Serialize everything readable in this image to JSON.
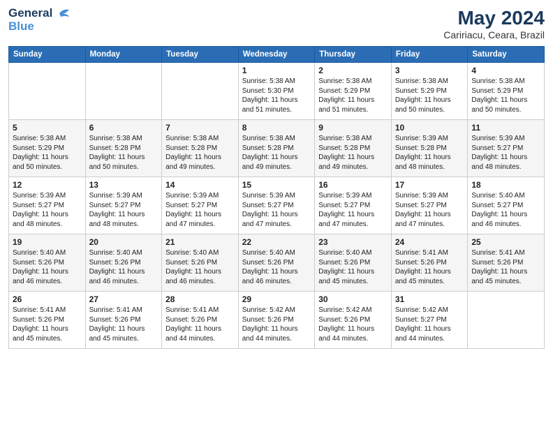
{
  "logo": {
    "line1": "General",
    "line2": "Blue"
  },
  "header": {
    "month_year": "May 2024",
    "location": "Caririacu, Ceara, Brazil"
  },
  "days_of_week": [
    "Sunday",
    "Monday",
    "Tuesday",
    "Wednesday",
    "Thursday",
    "Friday",
    "Saturday"
  ],
  "weeks": [
    [
      {
        "day": "",
        "sunrise": "",
        "sunset": "",
        "daylight": ""
      },
      {
        "day": "",
        "sunrise": "",
        "sunset": "",
        "daylight": ""
      },
      {
        "day": "",
        "sunrise": "",
        "sunset": "",
        "daylight": ""
      },
      {
        "day": "1",
        "sunrise": "Sunrise: 5:38 AM",
        "sunset": "Sunset: 5:30 PM",
        "daylight": "Daylight: 11 hours and 51 minutes."
      },
      {
        "day": "2",
        "sunrise": "Sunrise: 5:38 AM",
        "sunset": "Sunset: 5:29 PM",
        "daylight": "Daylight: 11 hours and 51 minutes."
      },
      {
        "day": "3",
        "sunrise": "Sunrise: 5:38 AM",
        "sunset": "Sunset: 5:29 PM",
        "daylight": "Daylight: 11 hours and 50 minutes."
      },
      {
        "day": "4",
        "sunrise": "Sunrise: 5:38 AM",
        "sunset": "Sunset: 5:29 PM",
        "daylight": "Daylight: 11 hours and 50 minutes."
      }
    ],
    [
      {
        "day": "5",
        "sunrise": "Sunrise: 5:38 AM",
        "sunset": "Sunset: 5:29 PM",
        "daylight": "Daylight: 11 hours and 50 minutes."
      },
      {
        "day": "6",
        "sunrise": "Sunrise: 5:38 AM",
        "sunset": "Sunset: 5:28 PM",
        "daylight": "Daylight: 11 hours and 50 minutes."
      },
      {
        "day": "7",
        "sunrise": "Sunrise: 5:38 AM",
        "sunset": "Sunset: 5:28 PM",
        "daylight": "Daylight: 11 hours and 49 minutes."
      },
      {
        "day": "8",
        "sunrise": "Sunrise: 5:38 AM",
        "sunset": "Sunset: 5:28 PM",
        "daylight": "Daylight: 11 hours and 49 minutes."
      },
      {
        "day": "9",
        "sunrise": "Sunrise: 5:38 AM",
        "sunset": "Sunset: 5:28 PM",
        "daylight": "Daylight: 11 hours and 49 minutes."
      },
      {
        "day": "10",
        "sunrise": "Sunrise: 5:39 AM",
        "sunset": "Sunset: 5:28 PM",
        "daylight": "Daylight: 11 hours and 48 minutes."
      },
      {
        "day": "11",
        "sunrise": "Sunrise: 5:39 AM",
        "sunset": "Sunset: 5:27 PM",
        "daylight": "Daylight: 11 hours and 48 minutes."
      }
    ],
    [
      {
        "day": "12",
        "sunrise": "Sunrise: 5:39 AM",
        "sunset": "Sunset: 5:27 PM",
        "daylight": "Daylight: 11 hours and 48 minutes."
      },
      {
        "day": "13",
        "sunrise": "Sunrise: 5:39 AM",
        "sunset": "Sunset: 5:27 PM",
        "daylight": "Daylight: 11 hours and 48 minutes."
      },
      {
        "day": "14",
        "sunrise": "Sunrise: 5:39 AM",
        "sunset": "Sunset: 5:27 PM",
        "daylight": "Daylight: 11 hours and 47 minutes."
      },
      {
        "day": "15",
        "sunrise": "Sunrise: 5:39 AM",
        "sunset": "Sunset: 5:27 PM",
        "daylight": "Daylight: 11 hours and 47 minutes."
      },
      {
        "day": "16",
        "sunrise": "Sunrise: 5:39 AM",
        "sunset": "Sunset: 5:27 PM",
        "daylight": "Daylight: 11 hours and 47 minutes."
      },
      {
        "day": "17",
        "sunrise": "Sunrise: 5:39 AM",
        "sunset": "Sunset: 5:27 PM",
        "daylight": "Daylight: 11 hours and 47 minutes."
      },
      {
        "day": "18",
        "sunrise": "Sunrise: 5:40 AM",
        "sunset": "Sunset: 5:27 PM",
        "daylight": "Daylight: 11 hours and 46 minutes."
      }
    ],
    [
      {
        "day": "19",
        "sunrise": "Sunrise: 5:40 AM",
        "sunset": "Sunset: 5:26 PM",
        "daylight": "Daylight: 11 hours and 46 minutes."
      },
      {
        "day": "20",
        "sunrise": "Sunrise: 5:40 AM",
        "sunset": "Sunset: 5:26 PM",
        "daylight": "Daylight: 11 hours and 46 minutes."
      },
      {
        "day": "21",
        "sunrise": "Sunrise: 5:40 AM",
        "sunset": "Sunset: 5:26 PM",
        "daylight": "Daylight: 11 hours and 46 minutes."
      },
      {
        "day": "22",
        "sunrise": "Sunrise: 5:40 AM",
        "sunset": "Sunset: 5:26 PM",
        "daylight": "Daylight: 11 hours and 46 minutes."
      },
      {
        "day": "23",
        "sunrise": "Sunrise: 5:40 AM",
        "sunset": "Sunset: 5:26 PM",
        "daylight": "Daylight: 11 hours and 45 minutes."
      },
      {
        "day": "24",
        "sunrise": "Sunrise: 5:41 AM",
        "sunset": "Sunset: 5:26 PM",
        "daylight": "Daylight: 11 hours and 45 minutes."
      },
      {
        "day": "25",
        "sunrise": "Sunrise: 5:41 AM",
        "sunset": "Sunset: 5:26 PM",
        "daylight": "Daylight: 11 hours and 45 minutes."
      }
    ],
    [
      {
        "day": "26",
        "sunrise": "Sunrise: 5:41 AM",
        "sunset": "Sunset: 5:26 PM",
        "daylight": "Daylight: 11 hours and 45 minutes."
      },
      {
        "day": "27",
        "sunrise": "Sunrise: 5:41 AM",
        "sunset": "Sunset: 5:26 PM",
        "daylight": "Daylight: 11 hours and 45 minutes."
      },
      {
        "day": "28",
        "sunrise": "Sunrise: 5:41 AM",
        "sunset": "Sunset: 5:26 PM",
        "daylight": "Daylight: 11 hours and 44 minutes."
      },
      {
        "day": "29",
        "sunrise": "Sunrise: 5:42 AM",
        "sunset": "Sunset: 5:26 PM",
        "daylight": "Daylight: 11 hours and 44 minutes."
      },
      {
        "day": "30",
        "sunrise": "Sunrise: 5:42 AM",
        "sunset": "Sunset: 5:26 PM",
        "daylight": "Daylight: 11 hours and 44 minutes."
      },
      {
        "day": "31",
        "sunrise": "Sunrise: 5:42 AM",
        "sunset": "Sunset: 5:27 PM",
        "daylight": "Daylight: 11 hours and 44 minutes."
      },
      {
        "day": "",
        "sunrise": "",
        "sunset": "",
        "daylight": ""
      }
    ]
  ]
}
